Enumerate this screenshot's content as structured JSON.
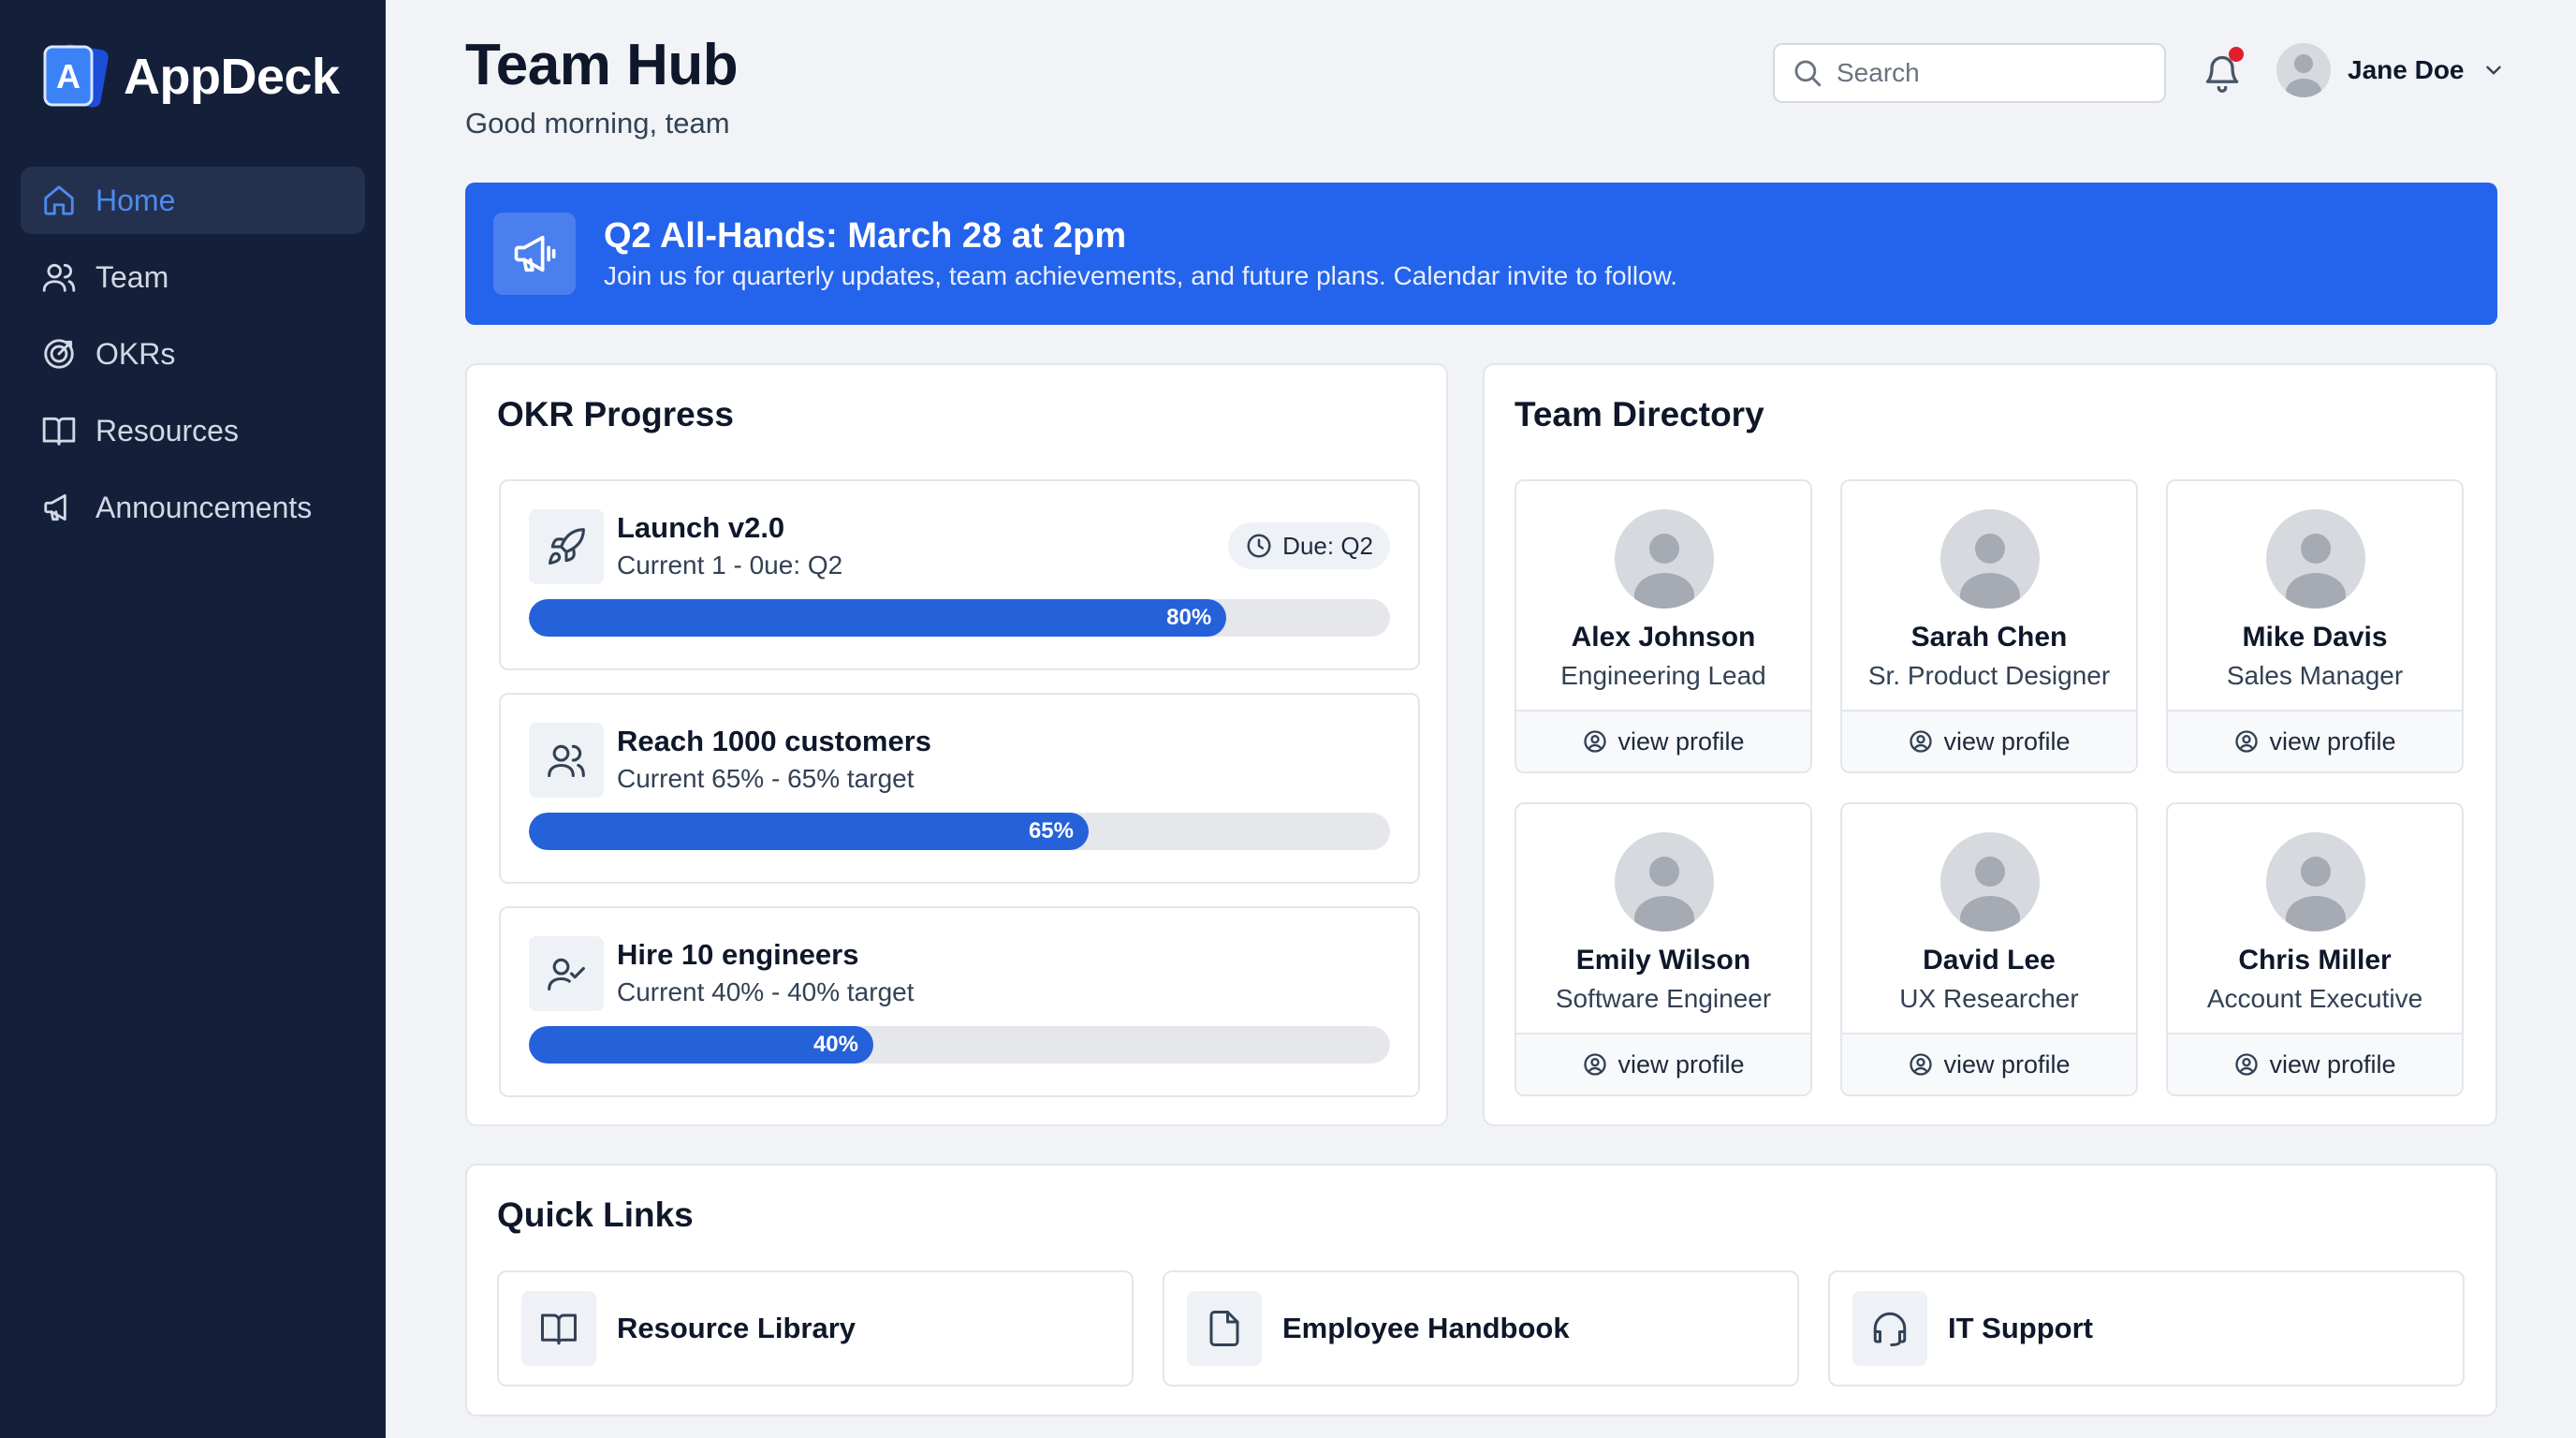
{
  "app": {
    "name": "AppDeck",
    "logo_letter": "A"
  },
  "sidebar": {
    "items": [
      {
        "label": "Home",
        "icon": "home-icon",
        "active": true
      },
      {
        "label": "Team",
        "icon": "users-icon"
      },
      {
        "label": "OKRs",
        "icon": "target-icon"
      },
      {
        "label": "Resources",
        "icon": "book-icon"
      },
      {
        "label": "Announcements",
        "icon": "megaphone-icon"
      }
    ]
  },
  "header": {
    "title": "Team Hub",
    "subtitle": "Good morning, team",
    "search_placeholder": "Search",
    "user_name": "Jane Doe",
    "has_notification": true
  },
  "banner": {
    "title": "Q2 All-Hands: March 28 at 2pm",
    "text": "Join us for quarterly updates, team achievements, and future plans. Calendar invite to follow.",
    "icon": "megaphone-icon",
    "color": "#2463eb"
  },
  "okr": {
    "title": "OKR Progress",
    "items": [
      {
        "name": "Launch v2.0",
        "meta": "Current 1 - 0ue: Q2",
        "due": "Due: Q2",
        "percent_label": "80%",
        "progress": 0.81,
        "icon": "rocket-icon"
      },
      {
        "name": "Reach 1000 customers",
        "meta": "Current 65% - 65% target",
        "percent_label": "65%",
        "progress": 0.65,
        "icon": "users-icon"
      },
      {
        "name": "Hire 10 engineers",
        "meta": "Current 40% - 40% target",
        "percent_label": "40%",
        "progress": 0.4,
        "icon": "user-check-icon"
      }
    ]
  },
  "directory": {
    "title": "Team Directory",
    "link_label": "view profile",
    "people": [
      {
        "name": "Alex Johnson",
        "role": "Engineering Lead"
      },
      {
        "name": "Sarah Chen",
        "role": "Sr. Product Designer"
      },
      {
        "name": "Mike Davis",
        "role": "Sales Manager"
      },
      {
        "name": "Emily Wilson",
        "role": "Software Engineer"
      },
      {
        "name": "David Lee",
        "role": "UX Researcher"
      },
      {
        "name": "Chris Miller",
        "role": "Account Executive"
      }
    ]
  },
  "quick_links": {
    "title": "Quick Links",
    "items": [
      {
        "label": "Resource Library",
        "icon": "book-icon"
      },
      {
        "label": "Employee Handbook",
        "icon": "document-icon"
      },
      {
        "label": "IT Support",
        "icon": "headset-icon"
      }
    ]
  },
  "colors": {
    "sidebar": "#141f3a",
    "accent": "#2463eb",
    "progress": "#2561d8",
    "notification": "#e11d2e"
  }
}
